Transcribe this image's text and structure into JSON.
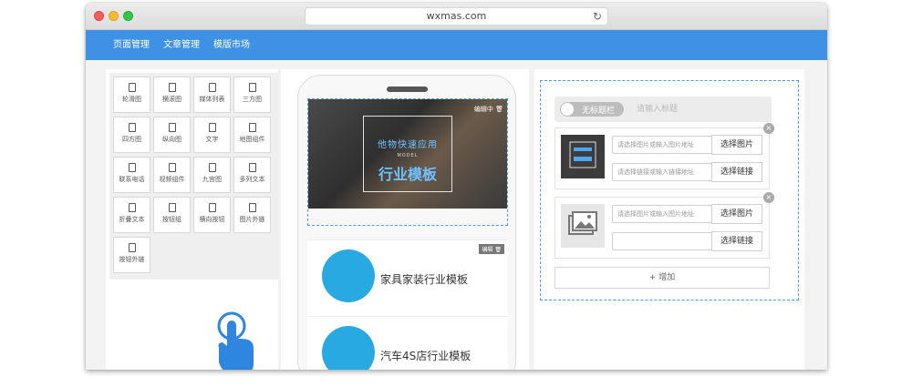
{
  "browser": {
    "url": "wxmas.com"
  },
  "nav": {
    "items": [
      {
        "label": "页面管理"
      },
      {
        "label": "文章管理"
      },
      {
        "label": "模版市场"
      }
    ]
  },
  "widgets": [
    {
      "label": "轮滑图"
    },
    {
      "label": "横滚图"
    },
    {
      "label": "媒体列表"
    },
    {
      "label": "三方图"
    },
    {
      "label": "四方图"
    },
    {
      "label": "纵向图"
    },
    {
      "label": "文字"
    },
    {
      "label": "地图组件"
    },
    {
      "label": "联系电话"
    },
    {
      "label": "视频组件"
    },
    {
      "label": "九宫图"
    },
    {
      "label": "多列文本"
    },
    {
      "label": "折叠文本"
    },
    {
      "label": "按钮组"
    },
    {
      "label": "横向按钮"
    },
    {
      "label": "图片外链"
    },
    {
      "label": "按钮外链"
    }
  ],
  "phone": {
    "banner": {
      "top_text": "他物快速应用",
      "model_text": "MODEL",
      "main_text": "行业模板",
      "editing_label": "编辑中"
    },
    "cards": [
      {
        "title": "家具家装行业模板",
        "edit_label": "编辑"
      },
      {
        "title": "汽车4S店行业模板",
        "edit_label": ""
      }
    ]
  },
  "editor": {
    "toggle_label": "无标题栏",
    "title_placeholder": "请输入标题",
    "image_placeholder": "请选择图片或输入图片地址",
    "link_placeholder": "请选择链接或输入链接地址",
    "select_image": "选择图片",
    "select_link": "选择链接",
    "add_label": "+ 增加"
  },
  "colors": {
    "nav": "#3f91e5",
    "accent": "#4a9be8",
    "hand": "#2f86e0"
  }
}
